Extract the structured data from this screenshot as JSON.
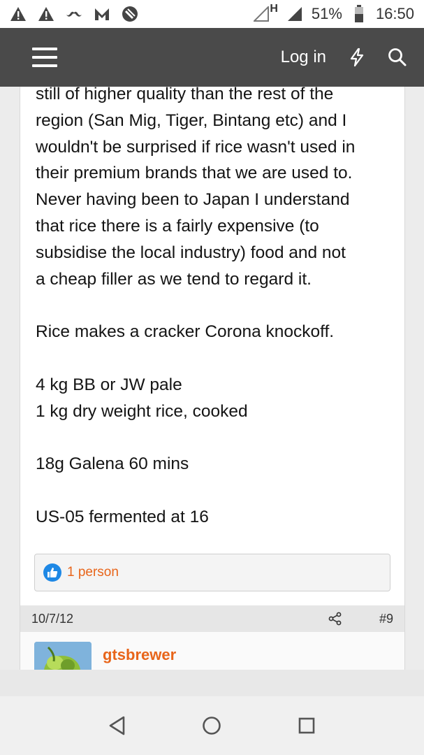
{
  "status_bar": {
    "network_type": "H",
    "battery": "51%",
    "time": "16:50",
    "icons": [
      "warning-icon",
      "warning-icon",
      "mustache-icon",
      "m-logo-icon",
      "no-entry-icon",
      "signal-empty-icon",
      "signal-icon",
      "battery-icon"
    ]
  },
  "header": {
    "login_label": "Log in",
    "menu_icon": "hamburger-icon",
    "whats_new_icon": "lightning-icon",
    "search_icon": "search-icon"
  },
  "post": {
    "lines": [
      "still of higher quality than the rest of the",
      "region (San Mig, Tiger, Bintang etc) and I",
      "wouldn't be surprised if rice wasn't used in",
      "their premium brands that we are used to.",
      "Never having been to Japan I understand",
      "that rice there is a fairly expensive (to",
      "subsidise the local industry) food and not",
      "a cheap filler as we tend to regard it."
    ],
    "para2": "Rice makes a cracker Corona knockoff.",
    "recipe_1": "4 kg BB or JW pale",
    "recipe_2": "1 kg dry weight rice, cooked",
    "hops": "18g Galena 60 mins",
    "yeast": "US-05 fermented at 16",
    "reactions": "1 person",
    "date": "10/7/12",
    "post_number": "#9"
  },
  "next_post": {
    "username": "gtsbrewer"
  },
  "colors": {
    "header_bg": "#4a4a4a",
    "accent": "#e8651a",
    "like_blue": "#1e88e5"
  }
}
